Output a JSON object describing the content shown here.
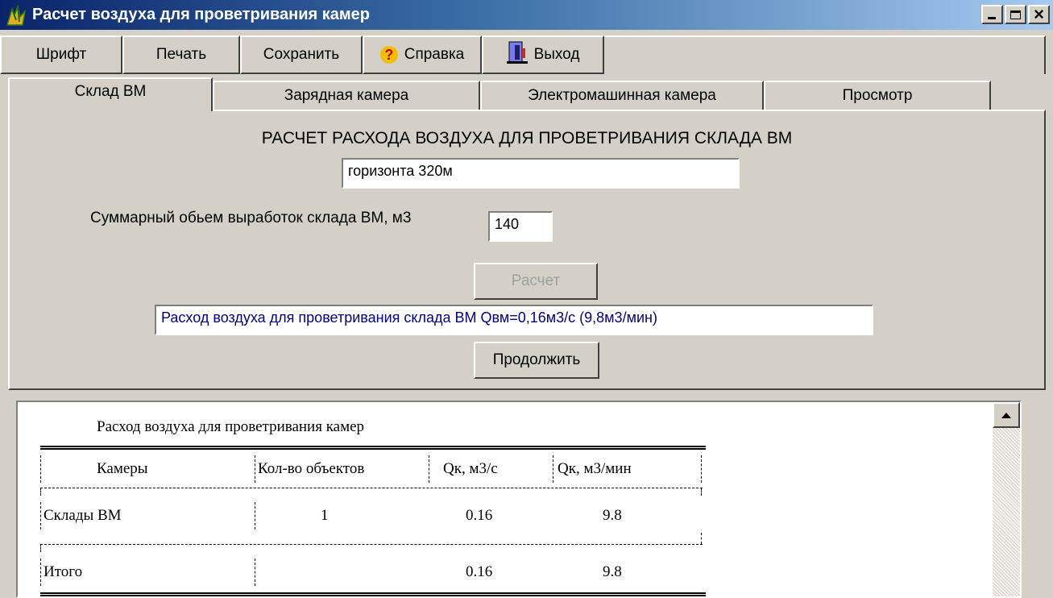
{
  "window": {
    "title": "Расчет воздуха для проветривания камер",
    "minimize_glyph": "_",
    "close_glyph": "×"
  },
  "menu": {
    "font": "Шрифт",
    "print": "Печать",
    "save": "Сохранить",
    "help": "Справка",
    "help_icon_glyph": "?",
    "exit": "Выход"
  },
  "tabs": {
    "sklad": "Склад ВМ",
    "zaryad": "Зарядная камера",
    "elektro": "Электромашинная камера",
    "prosmotr": "Просмотр"
  },
  "panel": {
    "heading": "РАСЧЕТ РАСХОДА ВОЗДУХА ДЛЯ ПРОВЕТРИВАНИЯ СКЛАДА ВМ",
    "horizon_value": "горизонта 320м",
    "volume_label": "Суммарный обьем выработок склада ВМ, м3",
    "volume_value": "140",
    "calc_button": "Расчет",
    "result_text": "Расход воздуха для проветривания склада ВМ  Qвм=0,16м3/с (9,8м3/мин)",
    "continue_button": "Продолжить"
  },
  "report": {
    "title": "Расход воздуха для проветривания камер",
    "headers": [
      "Камеры",
      "Кол-во объектов",
      "Qк, м3/с",
      "Qк, м3/мин"
    ],
    "rows": [
      {
        "name": "Склады ВМ",
        "count": "1",
        "qs": "0.16",
        "qm": "9.8"
      },
      {
        "name": "Итого",
        "count": "",
        "qs": "0.16",
        "qm": "9.8"
      }
    ]
  },
  "colors": {
    "window_bg": "#d4d0c8",
    "title_start": "#0a246a",
    "title_end": "#a6caf0",
    "result_text": "#000080",
    "help_icon": "#f0c000",
    "help_glyph": "#d00000"
  },
  "icons": {
    "app": "app-icon",
    "help": "question-icon",
    "exit": "door-exit-icon",
    "scroll_up": "arrow-up-icon"
  }
}
